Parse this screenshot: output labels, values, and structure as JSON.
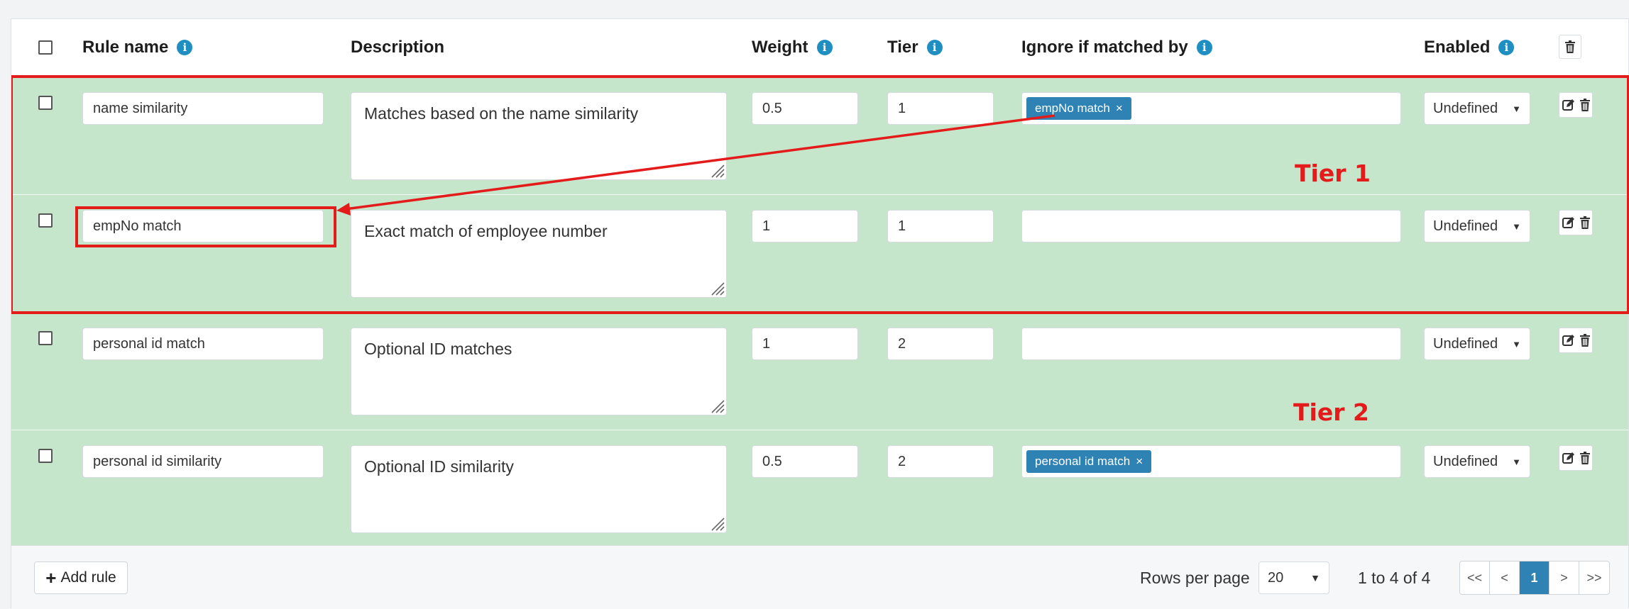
{
  "header": {
    "rule_name": "Rule name",
    "description": "Description",
    "weight": "Weight",
    "tier": "Tier",
    "ignore": "Ignore if matched by",
    "enabled": "Enabled"
  },
  "rows": [
    {
      "name": "name similarity",
      "description": "Matches based on the name similarity",
      "weight": "0.5",
      "tier": "1",
      "ignore_tags": [
        "empNo match"
      ],
      "enabled": "Undefined"
    },
    {
      "name": "empNo match",
      "description": "Exact match of employee number",
      "weight": "1",
      "tier": "1",
      "ignore_tags": [],
      "enabled": "Undefined"
    },
    {
      "name": "personal id match",
      "description": "Optional ID matches",
      "weight": "1",
      "tier": "2",
      "ignore_tags": [],
      "enabled": "Undefined"
    },
    {
      "name": "personal id similarity",
      "description": "Optional ID similarity",
      "weight": "0.5",
      "tier": "2",
      "ignore_tags": [
        "personal id match"
      ],
      "enabled": "Undefined"
    }
  ],
  "annotations": {
    "tier1": "Tier 1",
    "tier2": "Tier 2",
    "annotation_color": "#e41b1b"
  },
  "footer": {
    "add_rule": "Add rule",
    "rows_per_page_label": "Rows per page",
    "rows_per_page_value": "20",
    "range": "1 to 4 of 4",
    "pages": {
      "first": "<<",
      "prev": "<",
      "current": "1",
      "next": ">",
      "last": ">>"
    }
  },
  "colors": {
    "row_bg": "#c5e6cb",
    "tag_bg": "#2f82b4",
    "info_icon": "#1f8fc1"
  }
}
